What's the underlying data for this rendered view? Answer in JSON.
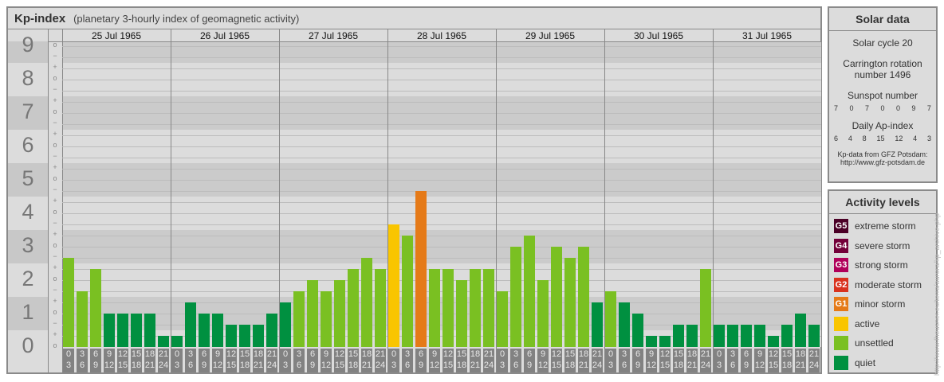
{
  "header": {
    "title": "Kp-index",
    "subtitle": "(planetary 3-hourly index of geomagnetic activity)"
  },
  "chart_data": {
    "type": "bar",
    "title": "Kp-index",
    "ylabel": "Kp",
    "ylim": [
      0,
      9
    ],
    "y_ticks": [
      "0",
      "1",
      "2",
      "3",
      "4",
      "5",
      "6",
      "7",
      "8",
      "9"
    ],
    "third_marks": [
      "o",
      "+",
      "−"
    ],
    "days": [
      "25 Jul 1965",
      "26 Jul 1965",
      "27 Jul 1965",
      "28 Jul 1965",
      "29 Jul 1965",
      "30 Jul 1965",
      "31 Jul 1965"
    ],
    "intervals": [
      [
        "0",
        "3"
      ],
      [
        "3",
        "6"
      ],
      [
        "6",
        "9"
      ],
      [
        "9",
        "12"
      ],
      [
        "12",
        "15"
      ],
      [
        "15",
        "18"
      ],
      [
        "18",
        "21"
      ],
      [
        "21",
        "24"
      ]
    ],
    "values_kp": [
      [
        2.667,
        1.667,
        2.333,
        1.0,
        1.0,
        1.0,
        1.0,
        0.333
      ],
      [
        0.333,
        1.333,
        1.0,
        1.0,
        0.667,
        0.667,
        0.667,
        1.0
      ],
      [
        1.333,
        1.667,
        2.0,
        1.667,
        2.0,
        2.333,
        2.667,
        2.333
      ],
      [
        3.667,
        3.333,
        4.667,
        2.333,
        2.333,
        2.0,
        2.333,
        2.333
      ],
      [
        1.667,
        3.0,
        3.333,
        2.0,
        3.0,
        2.667,
        3.0,
        1.333
      ],
      [
        1.667,
        1.333,
        1.0,
        0.333,
        0.333,
        0.667,
        0.667,
        2.333
      ],
      [
        0.667,
        0.667,
        0.667,
        0.667,
        0.333,
        0.667,
        1.0,
        0.667
      ]
    ]
  },
  "solar": {
    "title": "Solar data",
    "cycle": "Solar cycle 20",
    "carrington_1": "Carrington rotation",
    "carrington_2": "number 1496",
    "sunspot_title": "Sunspot number",
    "sunspots": [
      "7",
      "0",
      "7",
      "0",
      "0",
      "9",
      "7"
    ],
    "ap_title": "Daily Ap-index",
    "ap": [
      "6",
      "4",
      "8",
      "15",
      "12",
      "4",
      "3"
    ],
    "source_1": "Kp-data from GFZ Potsdam:",
    "source_2": "http://www.gfz-potsdam.de"
  },
  "legend": {
    "title": "Activity levels",
    "items": [
      {
        "badge": "G5",
        "label": "extreme storm",
        "color": "#4b0026"
      },
      {
        "badge": "G4",
        "label": "severe storm",
        "color": "#730039"
      },
      {
        "badge": "G3",
        "label": "strong storm",
        "color": "#b0005a"
      },
      {
        "badge": "G2",
        "label": "moderate storm",
        "color": "#d9321e"
      },
      {
        "badge": "G1",
        "label": "minor storm",
        "color": "#e57a18"
      },
      {
        "badge": "",
        "label": "active",
        "color": "#f9c500"
      },
      {
        "badge": "",
        "label": "unsettled",
        "color": "#7ac022"
      },
      {
        "badge": "",
        "label": "quiet",
        "color": "#009040"
      }
    ]
  },
  "credit": "http://www.fheusner.eu/terra/aurora/kp_archive.php"
}
